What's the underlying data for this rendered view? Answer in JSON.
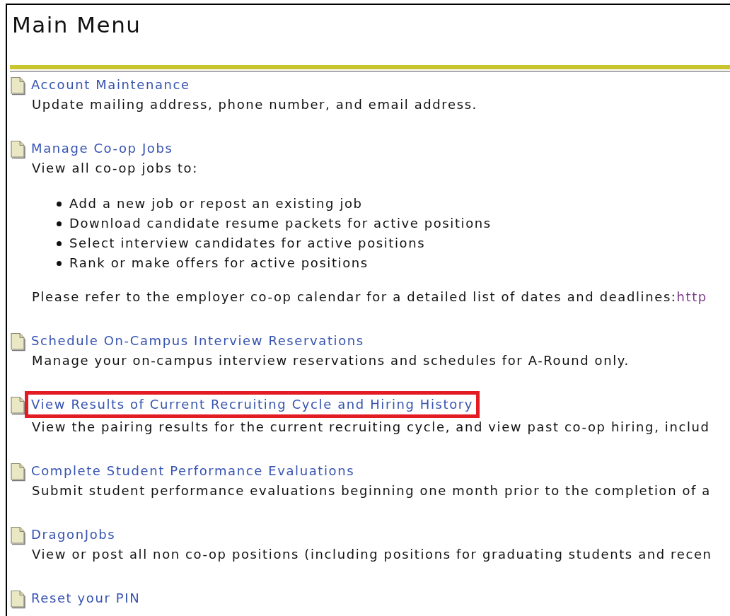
{
  "title": "Main Menu",
  "items": [
    {
      "link": "Account Maintenance",
      "description": "Update mailing address, phone number, and email address.",
      "highlighted": false
    },
    {
      "link": "Manage Co-op Jobs",
      "description": "View all co-op jobs to:",
      "bullets": [
        "Add a new job or repost an existing job",
        "Download candidate resume packets for active positions",
        "Select interview candidates for active positions",
        "Rank or make offers for active positions"
      ],
      "note": {
        "text": "Please refer to the employer co-op calendar for a detailed list of dates and deadlines:",
        "link": "http"
      },
      "highlighted": false
    },
    {
      "link": "Schedule On-Campus Interview Reservations",
      "description": "Manage your on-campus interview reservations and schedules for A-Round only.",
      "highlighted": false
    },
    {
      "link": "View Results of Current Recruiting Cycle and Hiring History",
      "description": "View the pairing results for the current recruiting cycle, and view past co-op hiring, includ",
      "highlighted": true
    },
    {
      "link": "Complete Student Performance Evaluations",
      "description": "Submit student performance evaluations beginning one month prior to the completion of a",
      "highlighted": false
    },
    {
      "link": "DragonJobs",
      "description": "View or post all non co-op positions (including positions for graduating students and recen",
      "highlighted": false
    },
    {
      "link": "Reset your PIN",
      "highlighted": false
    }
  ]
}
